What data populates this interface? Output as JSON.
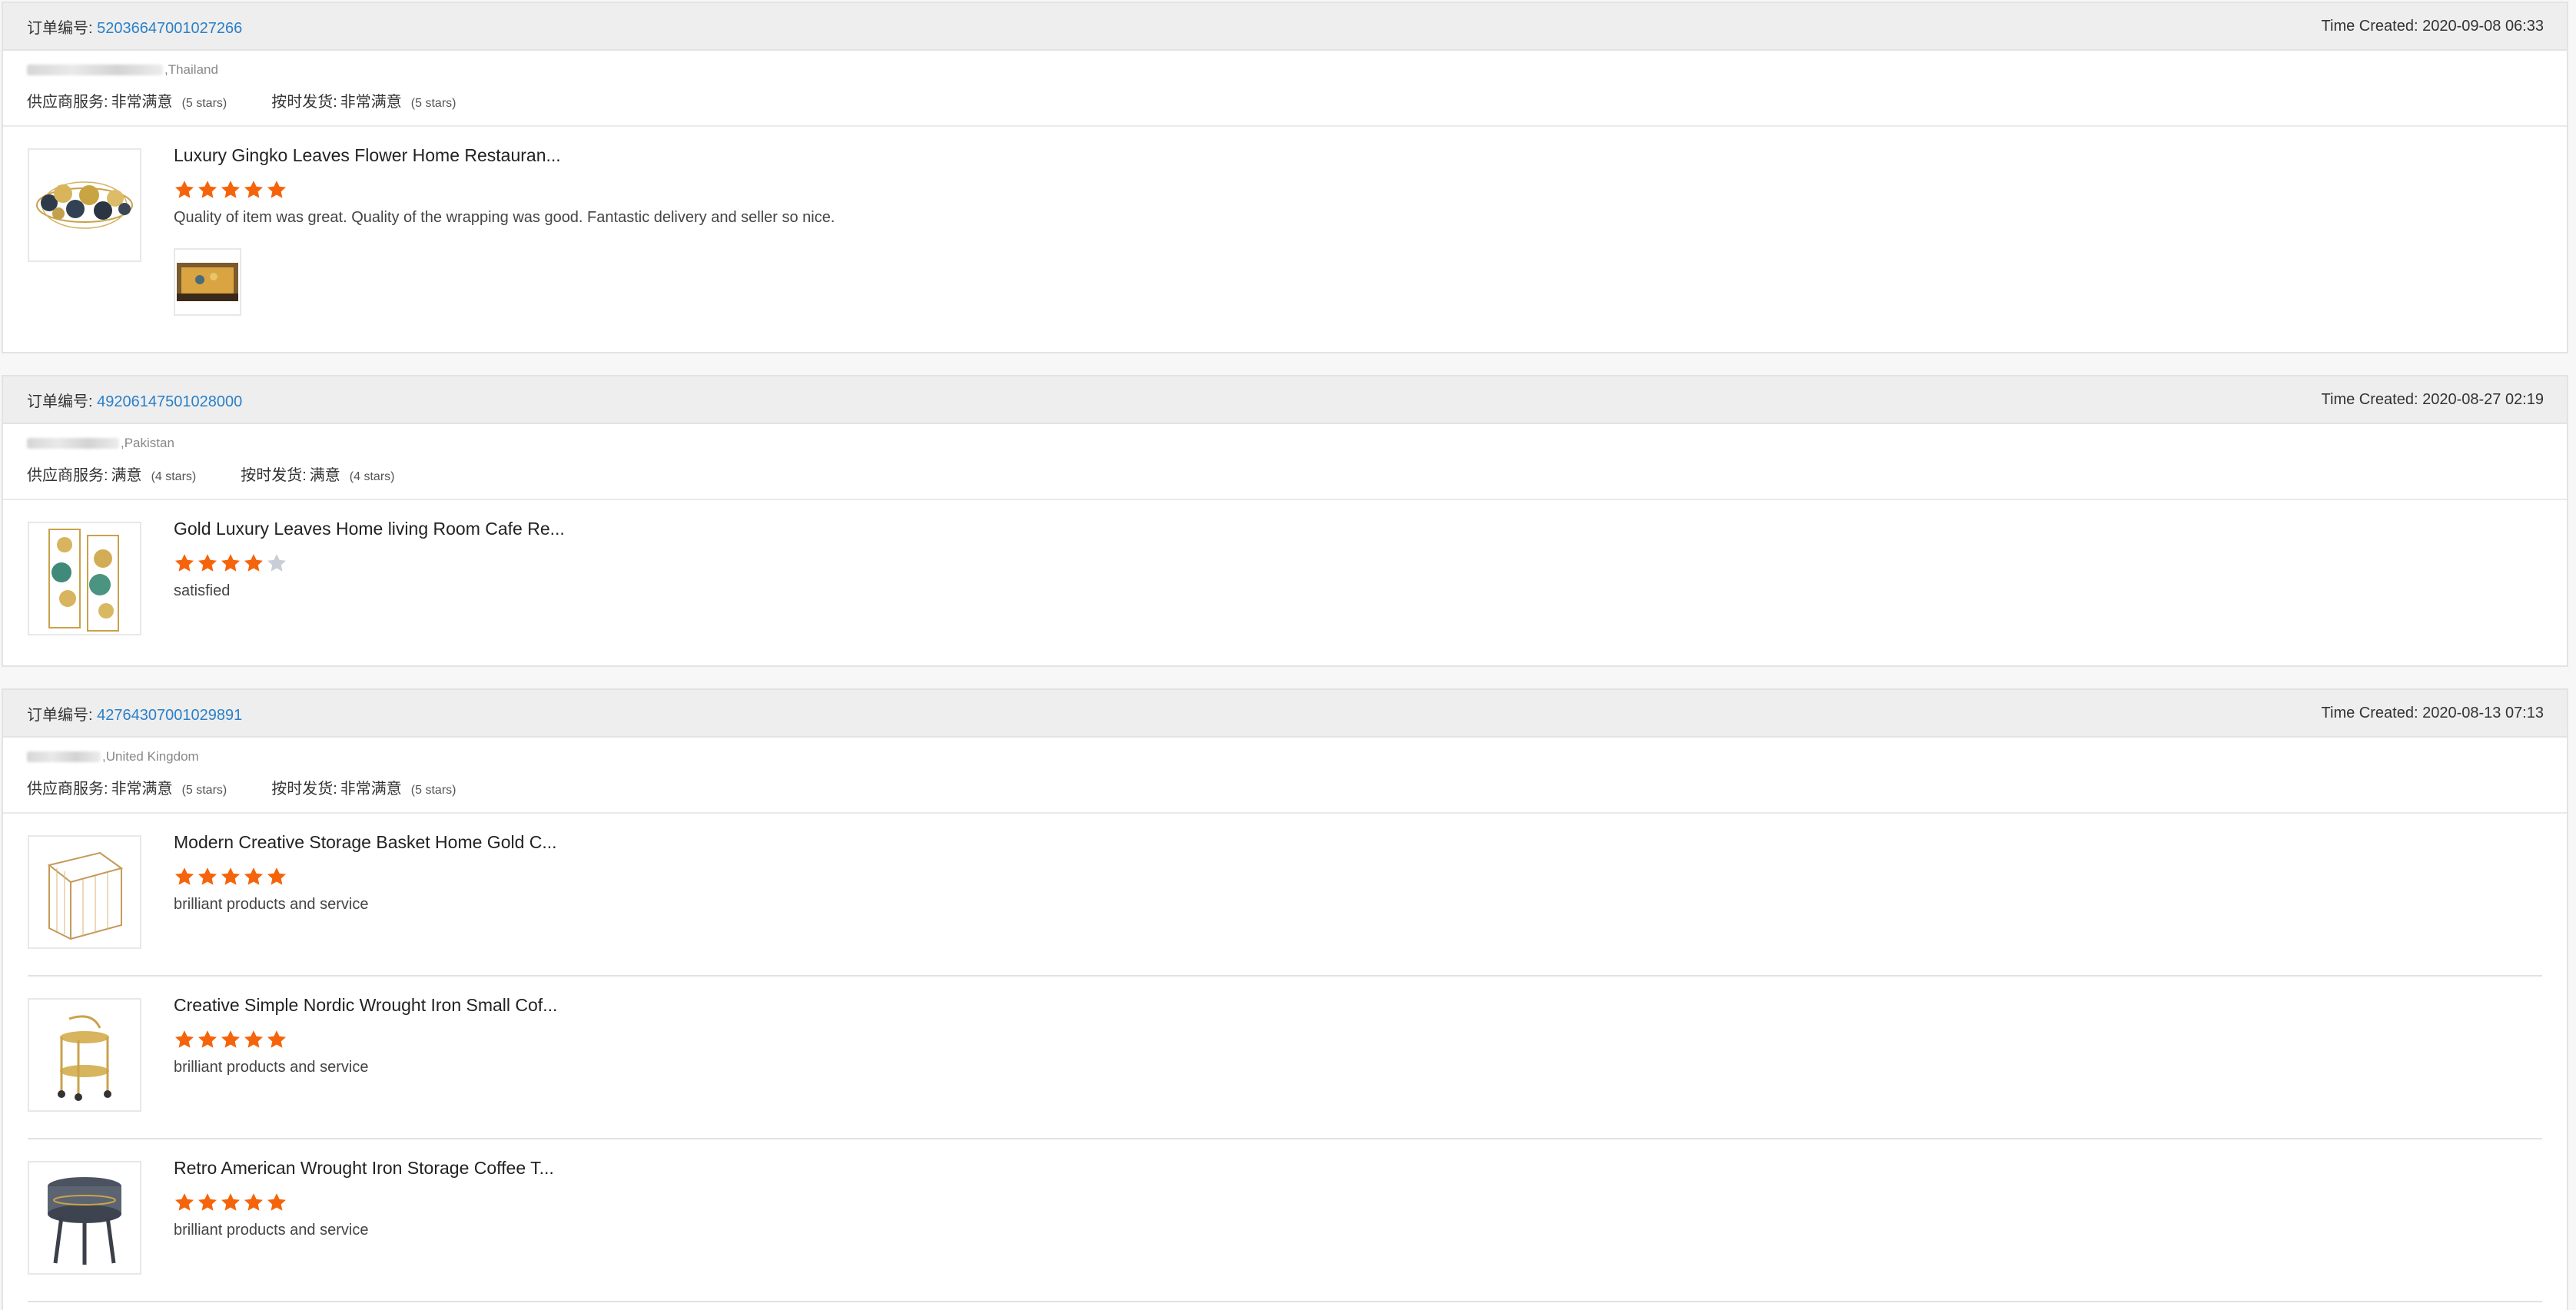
{
  "colors": {
    "link": "#2a7fc8",
    "star_filled": "#f5640a",
    "star_empty": "#c9ced6",
    "header_bg": "#eeeeee"
  },
  "labels": {
    "order_no": "订单编号: ",
    "time_created": "Time Created: ",
    "supplier_service": "供应商服务: ",
    "on_time_shipping": "按时发货: "
  },
  "orders": [
    {
      "order_no": "52036647001027266",
      "time_created": "2020-09-08 06:33",
      "buyer_country": ",Thailand",
      "supplier_service": {
        "value": "非常满意",
        "stars": "(5 stars)"
      },
      "on_time_shipping": {
        "value": "非常满意",
        "stars": "(5 stars)"
      },
      "products": [
        {
          "title": "Luxury Gingko Leaves Flower Home Restauran...",
          "rating": 5,
          "review": "Quality of item was great. Quality of the wrapping was good. Fantastic delivery and seller so nice.",
          "icon": "gingko-wall-art-icon",
          "has_photo": true
        }
      ]
    },
    {
      "order_no": "49206147501028000",
      "time_created": "2020-08-27 02:19",
      "buyer_country": ",Pakistan",
      "supplier_service": {
        "value": "满意",
        "stars": "(4 stars)"
      },
      "on_time_shipping": {
        "value": "满意",
        "stars": "(4 stars)"
      },
      "products": [
        {
          "title": "Gold Luxury Leaves Home living Room Cafe Re...",
          "rating": 4,
          "review": "satisfied",
          "icon": "leaf-panel-art-icon",
          "has_photo": false
        }
      ]
    },
    {
      "order_no": "42764307001029891",
      "time_created": "2020-08-13 07:13",
      "buyer_country": ",United Kingdom",
      "supplier_service": {
        "value": "非常满意",
        "stars": "(5 stars)"
      },
      "on_time_shipping": {
        "value": "非常满意",
        "stars": "(5 stars)"
      },
      "products": [
        {
          "title": "Modern Creative Storage Basket Home Gold C...",
          "rating": 5,
          "review": "brilliant products and service",
          "icon": "storage-basket-icon",
          "has_photo": false
        },
        {
          "title": "Creative Simple Nordic Wrought Iron Small Cof...",
          "rating": 5,
          "review": "brilliant products and service",
          "icon": "serving-cart-icon",
          "has_photo": false
        },
        {
          "title": "Retro American Wrought Iron Storage Coffee T...",
          "rating": 5,
          "review": "brilliant products and service",
          "icon": "coffee-table-icon",
          "has_photo": false
        }
      ]
    }
  ]
}
